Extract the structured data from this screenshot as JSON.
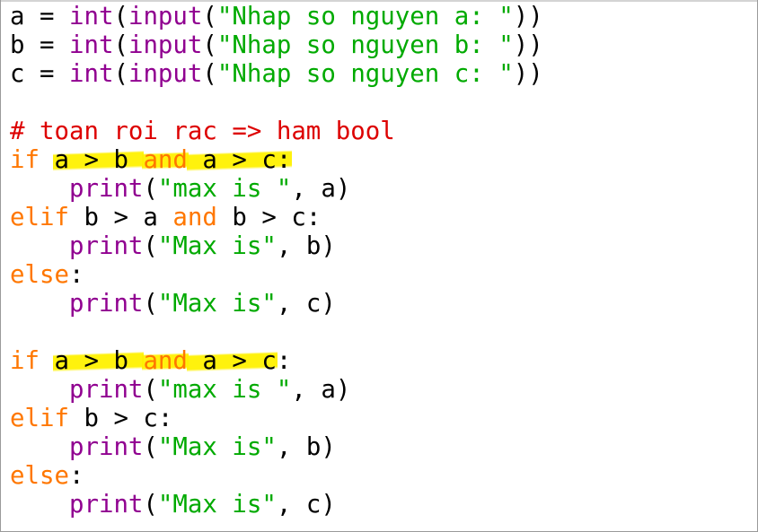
{
  "editor": {
    "lines": [
      [
        {
          "t": "a = ",
          "c": "plain"
        },
        {
          "t": "int",
          "c": "builtin"
        },
        {
          "t": "(",
          "c": "plain"
        },
        {
          "t": "input",
          "c": "builtin"
        },
        {
          "t": "(",
          "c": "plain"
        },
        {
          "t": "\"Nhap so nguyen a: \"",
          "c": "string"
        },
        {
          "t": "))",
          "c": "plain"
        }
      ],
      [
        {
          "t": "b = ",
          "c": "plain"
        },
        {
          "t": "int",
          "c": "builtin"
        },
        {
          "t": "(",
          "c": "plain"
        },
        {
          "t": "input",
          "c": "builtin"
        },
        {
          "t": "(",
          "c": "plain"
        },
        {
          "t": "\"Nhap so nguyen b: \"",
          "c": "string"
        },
        {
          "t": "))",
          "c": "plain"
        }
      ],
      [
        {
          "t": "c = ",
          "c": "plain"
        },
        {
          "t": "int",
          "c": "builtin"
        },
        {
          "t": "(",
          "c": "plain"
        },
        {
          "t": "input",
          "c": "builtin"
        },
        {
          "t": "(",
          "c": "plain"
        },
        {
          "t": "\"Nhap so nguyen c: \"",
          "c": "string"
        },
        {
          "t": "))",
          "c": "plain"
        }
      ],
      [],
      [
        {
          "t": "# toan roi rac => ham bool",
          "c": "comment"
        }
      ],
      [
        {
          "t": "if",
          "c": "keyword"
        },
        {
          "t": " ",
          "c": "plain"
        },
        {
          "t": "a > b ",
          "c": "plain",
          "hl": true
        },
        {
          "t": "and",
          "c": "keyword",
          "hl": true
        },
        {
          "t": " a > c:",
          "c": "plain",
          "hl": true
        }
      ],
      [
        {
          "t": "    ",
          "c": "plain"
        },
        {
          "t": "print",
          "c": "builtin"
        },
        {
          "t": "(",
          "c": "plain"
        },
        {
          "t": "\"max is \"",
          "c": "string"
        },
        {
          "t": ", a)",
          "c": "plain"
        }
      ],
      [
        {
          "t": "elif",
          "c": "keyword"
        },
        {
          "t": " b > a ",
          "c": "plain"
        },
        {
          "t": "and",
          "c": "keyword"
        },
        {
          "t": " b > c:",
          "c": "plain"
        }
      ],
      [
        {
          "t": "    ",
          "c": "plain"
        },
        {
          "t": "print",
          "c": "builtin"
        },
        {
          "t": "(",
          "c": "plain"
        },
        {
          "t": "\"Max is\"",
          "c": "string"
        },
        {
          "t": ", b)",
          "c": "plain"
        }
      ],
      [
        {
          "t": "else",
          "c": "keyword"
        },
        {
          "t": ":",
          "c": "plain"
        }
      ],
      [
        {
          "t": "    ",
          "c": "plain"
        },
        {
          "t": "print",
          "c": "builtin"
        },
        {
          "t": "(",
          "c": "plain"
        },
        {
          "t": "\"Max is\"",
          "c": "string"
        },
        {
          "t": ", c)",
          "c": "plain"
        }
      ],
      [],
      [
        {
          "t": "if",
          "c": "keyword"
        },
        {
          "t": " ",
          "c": "plain"
        },
        {
          "t": "a > b ",
          "c": "plain",
          "hl": true
        },
        {
          "t": "and",
          "c": "keyword",
          "hl": true
        },
        {
          "t": " a > c",
          "c": "plain",
          "hl": true
        },
        {
          "t": ":",
          "c": "plain"
        }
      ],
      [
        {
          "t": "    ",
          "c": "plain"
        },
        {
          "t": "print",
          "c": "builtin"
        },
        {
          "t": "(",
          "c": "plain"
        },
        {
          "t": "\"max is \"",
          "c": "string"
        },
        {
          "t": ", a)",
          "c": "plain"
        }
      ],
      [
        {
          "t": "elif",
          "c": "keyword"
        },
        {
          "t": " b > c:",
          "c": "plain"
        }
      ],
      [
        {
          "t": "    ",
          "c": "plain"
        },
        {
          "t": "print",
          "c": "builtin"
        },
        {
          "t": "(",
          "c": "plain"
        },
        {
          "t": "\"Max is\"",
          "c": "string"
        },
        {
          "t": ", b)",
          "c": "plain"
        }
      ],
      [
        {
          "t": "else",
          "c": "keyword"
        },
        {
          "t": ":",
          "c": "plain"
        }
      ],
      [
        {
          "t": "    ",
          "c": "plain"
        },
        {
          "t": "print",
          "c": "builtin"
        },
        {
          "t": "(",
          "c": "plain"
        },
        {
          "t": "\"Max is\"",
          "c": "string"
        },
        {
          "t": ", c)",
          "c": "plain"
        }
      ]
    ]
  },
  "colors": {
    "keyword": "#ff7700",
    "builtin": "#900090",
    "string": "#00aa00",
    "comment": "#dd0000",
    "plain": "#000000",
    "highlight": "#fff100"
  }
}
